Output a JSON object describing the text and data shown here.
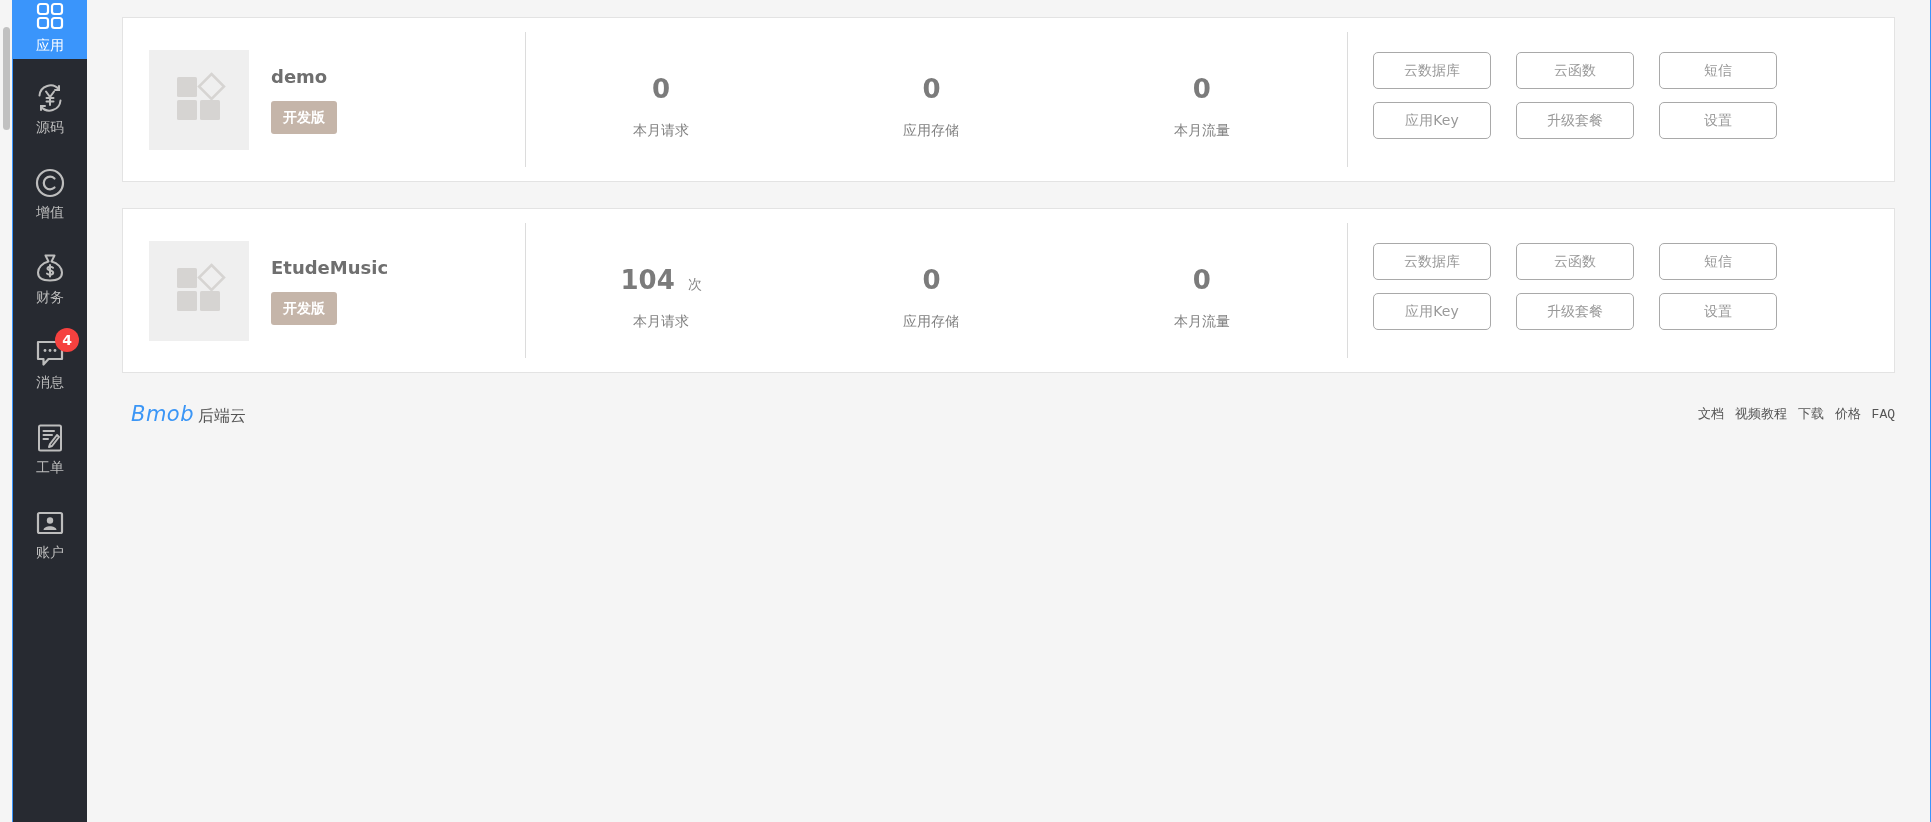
{
  "sidebar": {
    "items": [
      {
        "label": "应用",
        "selected": true
      },
      {
        "label": "源码",
        "selected": false
      },
      {
        "label": "增值",
        "selected": false
      },
      {
        "label": "财务",
        "selected": false
      },
      {
        "label": "消息",
        "selected": false,
        "badge": "4"
      },
      {
        "label": "工单",
        "selected": false
      },
      {
        "label": "账户",
        "selected": false
      }
    ]
  },
  "apps": [
    {
      "name": "demo",
      "badge": "开发版",
      "stats": [
        {
          "value": "0",
          "label": "本月请求"
        },
        {
          "value": "0",
          "label": "应用存储"
        },
        {
          "value": "0",
          "label": "本月流量"
        }
      ],
      "actions": [
        "云数据库",
        "云函数",
        "短信",
        "应用Key",
        "升级套餐",
        "设置"
      ]
    },
    {
      "name": "EtudeMusic",
      "badge": "开发版",
      "stats": [
        {
          "value": "104",
          "unit": "次",
          "label": "本月请求"
        },
        {
          "value": "0",
          "label": "应用存储"
        },
        {
          "value": "0",
          "label": "本月流量"
        }
      ],
      "actions": [
        "云数据库",
        "云函数",
        "短信",
        "应用Key",
        "升级套餐",
        "设置"
      ]
    }
  ],
  "footer": {
    "logo": {
      "wordmark": "Bmob",
      "tagline": "后端云"
    },
    "links": [
      "文档",
      "视频教程",
      "下载",
      "价格",
      "FAQ"
    ]
  }
}
